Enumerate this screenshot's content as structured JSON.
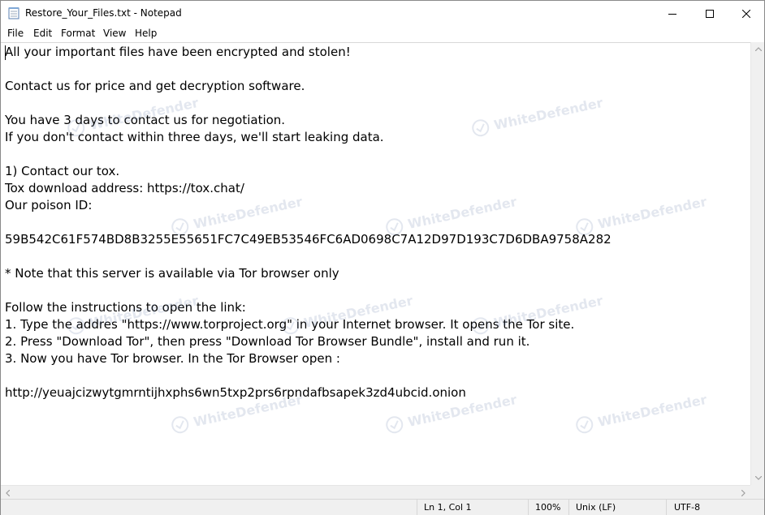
{
  "window": {
    "title": "Restore_Your_Files.txt - Notepad"
  },
  "menu": {
    "items": [
      "File",
      "Edit",
      "Format",
      "View",
      "Help"
    ]
  },
  "document": {
    "text": "All your important files have been encrypted and stolen!\n\nContact us for price and get decryption software.\n\nYou have 3 days to contact us for negotiation.\nIf you don't contact within three days, we'll start leaking data.\n\n1) Contact our tox.\nTox download address: https://tox.chat/\nOur poison ID:\n\n59B542C61F574BD8B3255E55651FC7C49EB53546FC6AD0698C7A12D97D193C7D6DBA9758A282\n\n* Note that this server is available via Tor browser only\n\nFollow the instructions to open the link:\n1. Type the addres \"https://www.torproject.org\" in your Internet browser. It opens the Tor site.\n2. Press \"Download Tor\", then press \"Download Tor Browser Bundle\", install and run it.\n3. Now you have Tor browser. In the Tor Browser open :\n\nhttp://yeuajcizwytgmrntijhxphs6wn5txp2prs6rpndafbsapek3zd4ubcid.onion"
  },
  "watermark": {
    "text": "WhiteDefender"
  },
  "status": {
    "position": "Ln 1, Col 1",
    "zoom": "100%",
    "line_ending": "Unix (LF)",
    "encoding": "UTF-8"
  },
  "icons": {
    "app": "notepad-icon",
    "minimize": "minimize-icon",
    "maximize": "maximize-icon",
    "close": "close-icon"
  },
  "colors": {
    "text": "#000000",
    "chrome": "#f0f0f0",
    "watermark": "#6a7fa8"
  }
}
